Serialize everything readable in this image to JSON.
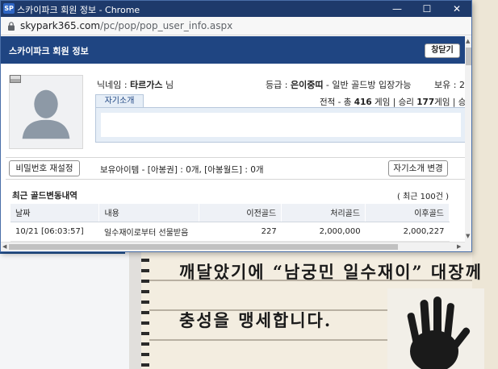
{
  "window": {
    "logo": "SP",
    "title": "스카이파크 회원 정보 - Chrome",
    "controls": {
      "minimize": "—",
      "maximize": "☐",
      "close": "✕"
    }
  },
  "address": {
    "domain": "skypark365.com",
    "path": "/pc/pop/pop_user_info.aspx"
  },
  "header": {
    "title": "스카이파크 회원 정보",
    "close_label": "창닫기"
  },
  "profile": {
    "nickname_label": "닉네임 : ",
    "nickname": "타르가스",
    "nickname_suffix": " 님",
    "grade_label": "등급 : ",
    "grade": "은이중띠",
    "grade_note": " - 일반 골드방 입장가능",
    "holdings_label": "보유 : 2",
    "intro_tab": "자기소개",
    "record_prefix": "전적 - 총 ",
    "record_total": "416",
    "record_mid": " 게임 | 승리 ",
    "record_wins": "177",
    "record_suffix": "게임 | 승"
  },
  "actions": {
    "reset_password": "비밀번호 재설정",
    "items_text": "보유아이템 - [아봉권] : 0개, [아봉월드] : 0개",
    "edit_intro": "자기소개 변경"
  },
  "history": {
    "title": "최근 골드변동내역",
    "recent_note": "( 최근 100건 )",
    "columns": [
      "날짜",
      "내용",
      "이전골드",
      "처리골드",
      "이후골드"
    ],
    "rows": [
      {
        "date": "10/21 [06:03:57]",
        "content": "일수재이로부터 선물받음",
        "before": "227",
        "amount": "2,000,000",
        "after": "2,000,227"
      }
    ]
  },
  "background": {
    "line1": "깨달았기에 “남궁민 일수재이” 대장께",
    "line2": "충성을 맹세합니다."
  }
}
